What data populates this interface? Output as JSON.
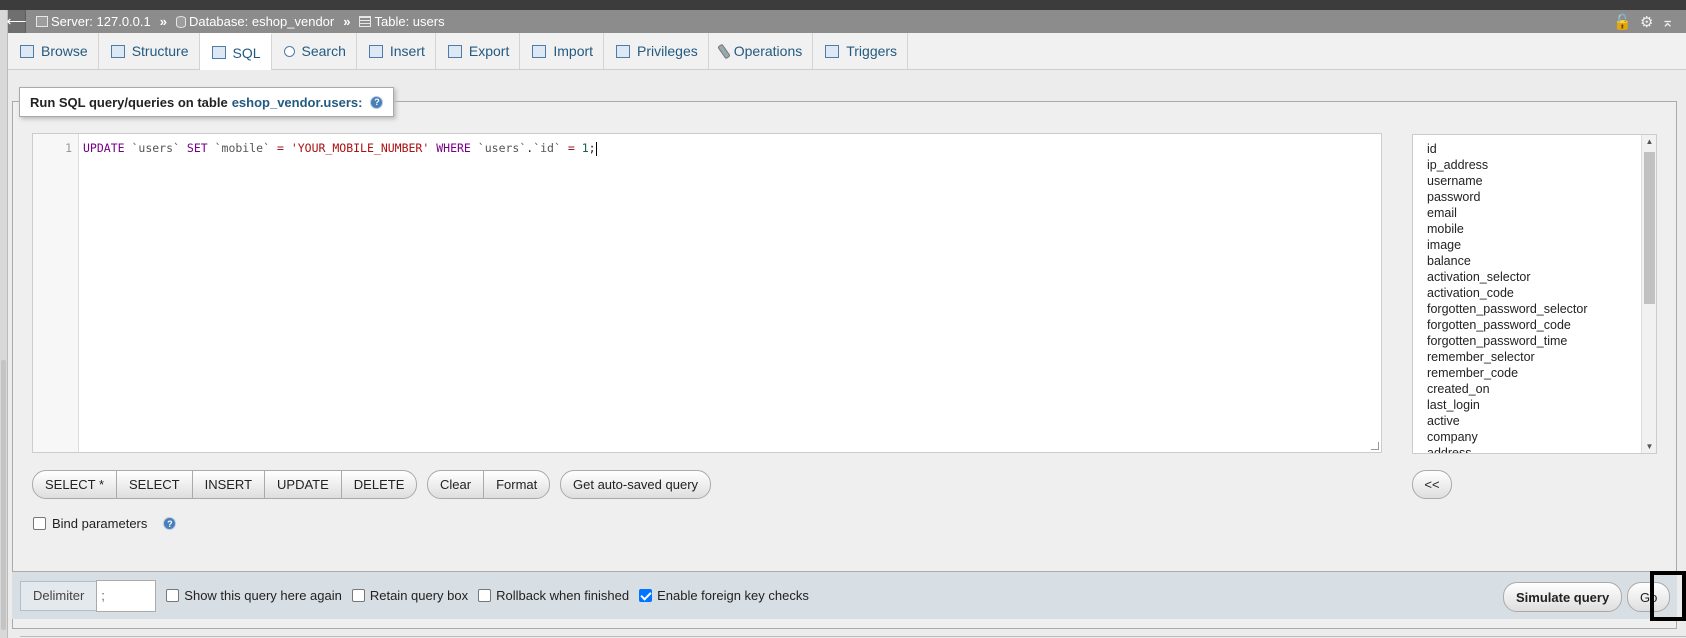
{
  "breadcrumb": {
    "server": "Server: 127.0.0.1",
    "database": "Database: eshop_vendor",
    "table": "Table: users",
    "separator": "»"
  },
  "tabs": [
    {
      "label": "Browse",
      "icon": "browse-icon"
    },
    {
      "label": "Structure",
      "icon": "structure-icon"
    },
    {
      "label": "SQL",
      "icon": "sql-icon",
      "active": true
    },
    {
      "label": "Search",
      "icon": "search-icon"
    },
    {
      "label": "Insert",
      "icon": "insert-icon"
    },
    {
      "label": "Export",
      "icon": "export-icon"
    },
    {
      "label": "Import",
      "icon": "import-icon"
    },
    {
      "label": "Privileges",
      "icon": "privileges-icon"
    },
    {
      "label": "Operations",
      "icon": "operations-icon"
    },
    {
      "label": "Triggers",
      "icon": "triggers-icon"
    }
  ],
  "legend": {
    "prefix": "Run SQL query/queries on table",
    "table": "eshop_vendor.users:"
  },
  "editor": {
    "line_number": "1",
    "tokens": [
      {
        "t": "UPDATE",
        "c": "kw"
      },
      {
        "t": " ",
        "c": ""
      },
      {
        "t": "`users`",
        "c": "bt"
      },
      {
        "t": " ",
        "c": ""
      },
      {
        "t": "SET",
        "c": "kw"
      },
      {
        "t": " ",
        "c": ""
      },
      {
        "t": "`mobile`",
        "c": "bt"
      },
      {
        "t": " ",
        "c": ""
      },
      {
        "t": "=",
        "c": "op"
      },
      {
        "t": " ",
        "c": ""
      },
      {
        "t": "'YOUR_MOBILE_NUMBER'",
        "c": "str"
      },
      {
        "t": " ",
        "c": ""
      },
      {
        "t": "WHERE",
        "c": "kw"
      },
      {
        "t": " ",
        "c": ""
      },
      {
        "t": "`users`",
        "c": "bt"
      },
      {
        "t": ".",
        "c": ""
      },
      {
        "t": "`id`",
        "c": "bt"
      },
      {
        "t": " ",
        "c": ""
      },
      {
        "t": "=",
        "c": "op"
      },
      {
        "t": " ",
        "c": ""
      },
      {
        "t": "1",
        "c": "num"
      },
      {
        "t": ";",
        "c": ""
      }
    ]
  },
  "columns": [
    "id",
    "ip_address",
    "username",
    "password",
    "email",
    "mobile",
    "image",
    "balance",
    "activation_selector",
    "activation_code",
    "forgotten_password_selector",
    "forgotten_password_code",
    "forgotten_password_time",
    "remember_selector",
    "remember_code",
    "created_on",
    "last_login",
    "active",
    "company",
    "address"
  ],
  "query_buttons": [
    "SELECT *",
    "SELECT",
    "INSERT",
    "UPDATE",
    "DELETE"
  ],
  "edit_buttons": [
    "Clear",
    "Format"
  ],
  "autosave_label": "Get auto-saved query",
  "insert_column_label": "<<",
  "bind_parameters_label": "Bind parameters",
  "footer": {
    "delimiter_label": "Delimiter",
    "delimiter_value": ";",
    "show_query_label": "Show this query here again",
    "retain_label": "Retain query box",
    "rollback_label": "Rollback when finished",
    "fk_label": "Enable foreign key checks",
    "simulate_label": "Simulate query",
    "go_label": "Go"
  },
  "colors": {
    "link": "#235a81",
    "accent": "#0075ff"
  }
}
